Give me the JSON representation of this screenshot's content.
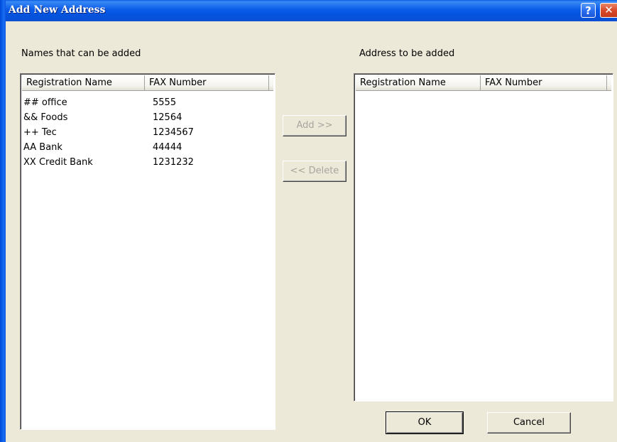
{
  "window": {
    "title": "Add New Address",
    "help_glyph": "?",
    "close_glyph": "✕"
  },
  "left_panel": {
    "label": "Names that can be added",
    "columns": [
      "Registration Name",
      "FAX Number"
    ],
    "rows": [
      {
        "name": "## office",
        "fax": "5555"
      },
      {
        "name": "&& Foods",
        "fax": "12564"
      },
      {
        "name": "++ Tec",
        "fax": "1234567"
      },
      {
        "name": "AA Bank",
        "fax": "44444"
      },
      {
        "name": "XX Credit Bank",
        "fax": "1231232"
      }
    ]
  },
  "right_panel": {
    "label": "Address to be added",
    "columns": [
      "Registration Name",
      "FAX Number"
    ],
    "rows": []
  },
  "buttons": {
    "add": "Add >>",
    "delete": "<< Delete",
    "ok": "OK",
    "cancel": "Cancel"
  }
}
